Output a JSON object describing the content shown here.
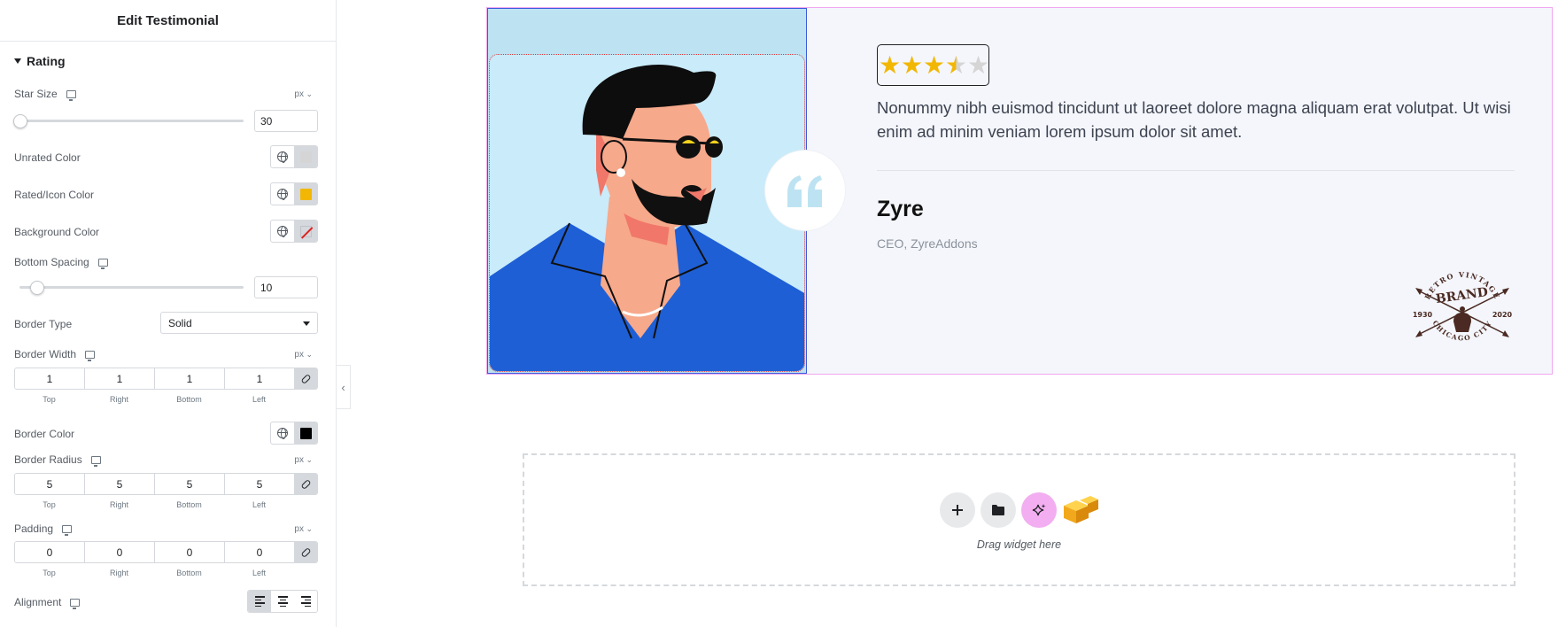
{
  "panel": {
    "title": "Edit Testimonial",
    "section": "Rating",
    "star_size": {
      "label": "Star Size",
      "unit": "px",
      "value": "30",
      "level": 0.0
    },
    "unrated_color": {
      "label": "Unrated Color",
      "color": "#d5d5d5"
    },
    "rated_color": {
      "label": "Rated/Icon Color",
      "color": "#f2b705"
    },
    "background_color": {
      "label": "Background Color",
      "color": "none"
    },
    "bottom_spacing": {
      "label": "Bottom Spacing",
      "value": "10",
      "level": 0.1
    },
    "border_type": {
      "label": "Border Type",
      "value": "Solid"
    },
    "border_width": {
      "label": "Border Width",
      "unit": "px",
      "values": [
        "1",
        "1",
        "1",
        "1"
      ]
    },
    "side_labels": [
      "Top",
      "Right",
      "Bottom",
      "Left"
    ],
    "border_color": {
      "label": "Border Color",
      "color": "#000000"
    },
    "border_radius": {
      "label": "Border Radius",
      "unit": "px",
      "values": [
        "5",
        "5",
        "5",
        "5"
      ]
    },
    "padding": {
      "label": "Padding",
      "unit": "px",
      "values": [
        "0",
        "0",
        "0",
        "0"
      ]
    },
    "alignment": {
      "label": "Alignment",
      "selected": "left"
    }
  },
  "testimonial": {
    "rating": 3.5,
    "rating_max": 5,
    "text": "Nonummy nibh euismod tincidunt ut laoreet dolore magna aliquam erat volutpat. Ut wisi enim ad minim veniam lorem ipsum dolor sit amet.",
    "name": "Zyre",
    "role": "CEO, ZyreAddons",
    "brand_logo_text": [
      "RETRO VINTAGE",
      "BRAND",
      "1930",
      "2020",
      "CHICAGO CITY"
    ]
  },
  "canvas": {
    "drop_hint": "Drag widget here",
    "icons": [
      "plus-icon",
      "folder-icon",
      "ai-sparkle-icon",
      "zyre-cube-icon"
    ]
  }
}
